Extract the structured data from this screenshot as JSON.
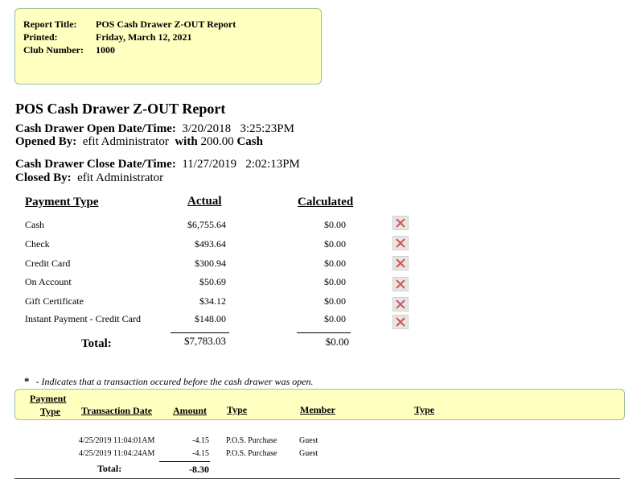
{
  "header": {
    "report_title_label": "Report Title:",
    "report_title": "POS Cash Drawer Z-OUT Report",
    "printed_label": "Printed:",
    "printed": "Friday, March 12, 2021",
    "club_label": "Club Number:",
    "club_number": "1000"
  },
  "report": {
    "title": "POS Cash Drawer Z-OUT Report",
    "open_label": "Cash Drawer Open Date/Time:",
    "open_date": "3/20/2018",
    "open_time": "3:25:23PM",
    "opened_by_label": "Opened By:",
    "opened_by": "efit Administrator",
    "with_label": "with",
    "opening_amount": "200.00",
    "opening_amount_type": "Cash",
    "close_label": "Cash Drawer Close Date/Time:",
    "close_date": "11/27/2019",
    "close_time": "2:02:13PM",
    "closed_by_label": "Closed By:",
    "closed_by": "efit Administrator"
  },
  "payments": {
    "headers": {
      "type": "Payment Type",
      "actual": "Actual",
      "calculated": "Calculated"
    },
    "rows": [
      {
        "type": "Cash",
        "actual": "$6,755.64",
        "calculated": "$0.00"
      },
      {
        "type": "Check",
        "actual": "$493.64",
        "calculated": "$0.00"
      },
      {
        "type": "Credit Card",
        "actual": "$300.94",
        "calculated": "$0.00"
      },
      {
        "type": "On Account",
        "actual": "$50.69",
        "calculated": "$0.00"
      },
      {
        "type": "Gift Certificate",
        "actual": "$34.12",
        "calculated": "$0.00"
      },
      {
        "type": "Instant Payment - Credit Card",
        "actual": "$148.00",
        "calculated": "$0.00"
      }
    ],
    "total_label": "Total:",
    "total_actual": "$7,783.03",
    "total_calculated": "$0.00"
  },
  "note": {
    "star": "*",
    "text": "- Indicates that a transaction occured before the cash drawer was open."
  },
  "transactions": {
    "headers": {
      "payment_line1": "Payment",
      "payment_line2": "Type",
      "date": "Transaction Date",
      "amount": "Amount",
      "type": "Type",
      "member": "Member",
      "type2": "Type"
    },
    "rows": [
      {
        "date": "4/25/2019 11:04:01AM",
        "amount": "-4.15",
        "type": "P.O.S. Purchase",
        "member": "Guest"
      },
      {
        "date": "4/25/2019 11:04:24AM",
        "amount": "-4.15",
        "type": "P.O.S. Purchase",
        "member": "Guest"
      }
    ],
    "total_label": "Total:",
    "total_amount": "-8.30"
  },
  "colors": {
    "box_fill": "#ffffc0",
    "box_border": "#9bbf9b",
    "delete_icon": "#d9534f"
  }
}
